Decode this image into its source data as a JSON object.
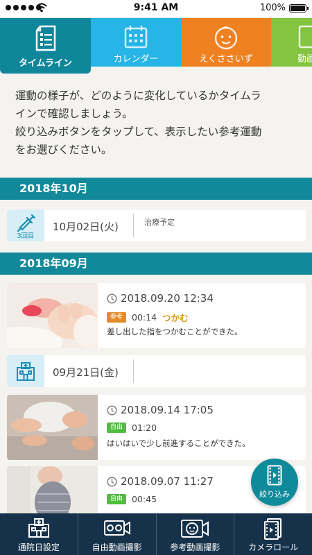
{
  "status_bar": {
    "time": "9:41 AM",
    "battery": "100%"
  },
  "tabs": [
    {
      "label": "タイムライン",
      "icon": "list-document-icon"
    },
    {
      "label": "カレンダー",
      "icon": "calendar-icon"
    },
    {
      "label": "えくささいず",
      "icon": "baby-face-icon"
    },
    {
      "label": "動画",
      "icon": "video-icon"
    }
  ],
  "intro": {
    "line1": "運動の様子が、どのように変化しているかタイムラ",
    "line2": "インで確認しましょう。",
    "line3": "絞り込みボタンをタップして、表示したい参考運動",
    "line4": "をお選びください。"
  },
  "months": [
    "2018年10月",
    "2018年09月"
  ],
  "events": [
    {
      "date": "10月02日(火)",
      "icon": "syringe-icon",
      "sub": "3回目",
      "note": "治療予定"
    },
    {
      "date": "09月21日(金)",
      "icon": "hospital-icon",
      "sub": "",
      "note": ""
    }
  ],
  "videos": [
    {
      "datetime": "2018.09.20 12:34",
      "badge": "参考",
      "duration": "00:14",
      "motion": "つかむ",
      "desc": "差し出した指をつかむことができた。"
    },
    {
      "datetime": "2018.09.14 17:05",
      "badge": "自由",
      "duration": "01:20",
      "motion": "",
      "desc": "はいはいで少し前進することができた。"
    },
    {
      "datetime": "2018.09.07 11:27",
      "badge": "自由",
      "duration": "00:45",
      "motion": "",
      "desc": ""
    }
  ],
  "filter_button": {
    "label": "絞り込み"
  },
  "bottom_nav": [
    {
      "label": "通院日設定",
      "icon": "hospital-calendar-icon"
    },
    {
      "label": "自由動画撮影",
      "icon": "video-camera-icon"
    },
    {
      "label": "参考動画撮影",
      "icon": "reference-camera-icon"
    },
    {
      "label": "カメラロール",
      "icon": "film-roll-icon"
    }
  ],
  "colors": {
    "teal": "#12899b",
    "calendar_blue": "#27b4e6",
    "orange": "#f08121",
    "green": "#84c441",
    "nav_dark": "#16324a"
  }
}
